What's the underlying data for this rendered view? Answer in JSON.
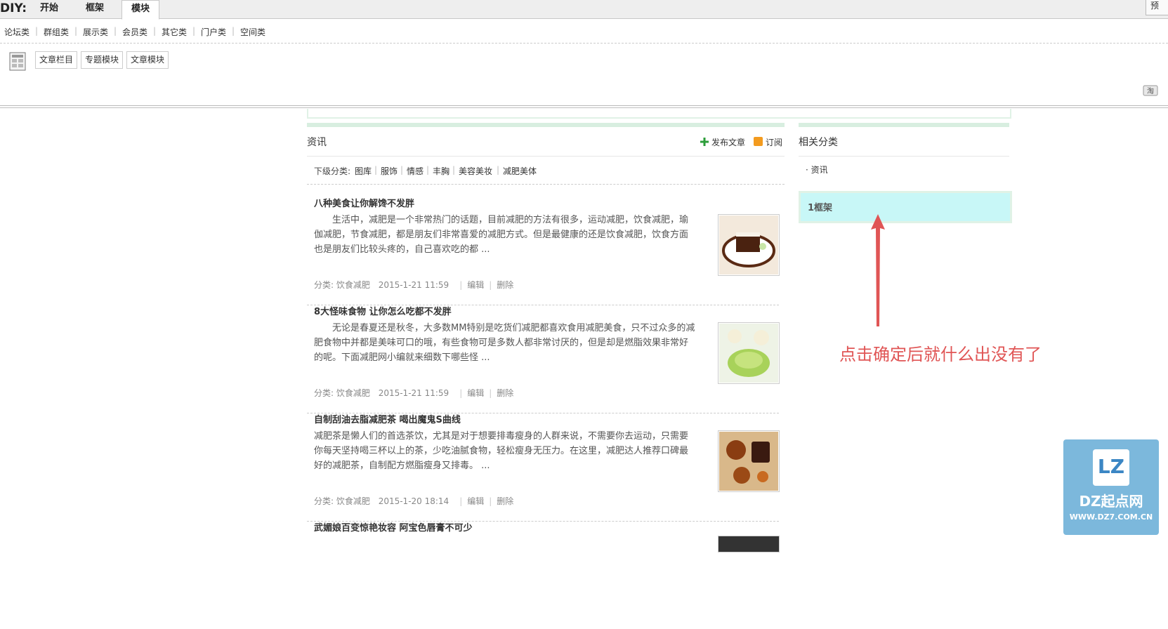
{
  "diy": {
    "label": "DIY:",
    "tabs": [
      {
        "label": "开始"
      },
      {
        "label": "框架"
      },
      {
        "label": "模块"
      }
    ],
    "right_button": "预",
    "categories": [
      "论坛类",
      "群组类",
      "展示类",
      "会员类",
      "其它类",
      "门户类",
      "空间类"
    ],
    "module_buttons": [
      "文章栏目",
      "专题模块",
      "文章模块"
    ],
    "corner_icon_text": "淘"
  },
  "main": {
    "title": "资讯",
    "publish_label": "发布文章",
    "subscribe_label": "订阅",
    "sub_label": "下级分类:",
    "sub_categories": [
      "图库",
      "服饰",
      "情感",
      "丰胸",
      "美容美妆",
      "减肥美体"
    ],
    "articles": [
      {
        "title": "八种美食让你解馋不发胖",
        "summary": "　　生活中，减肥是一个非常热门的话题，目前减肥的方法有很多，运动减肥，饮食减肥，瑜伽减肥，节食减肥，都是朋友们非常喜爱的减肥方式。但是最健康的还是饮食减肥，饮食方面也是朋友们比较头疼的，自己喜欢吃的都 ...",
        "category": "分类: 饮食减肥",
        "date": "2015-1-21 11:59",
        "edit": "编辑",
        "delete": "删除"
      },
      {
        "title": "8大怪味食物 让你怎么吃都不发胖",
        "summary": "　　无论是春夏还是秋冬，大多数MM特别是吃货们减肥都喜欢食用减肥美食，只不过众多的减肥食物中并都是美味可口的哦，有些食物可是多数人都非常讨厌的，但是却是燃脂效果非常好的呢。下面减肥网小编就来细数下哪些怪 ...",
        "category": "分类: 饮食减肥",
        "date": "2015-1-21 11:59",
        "edit": "编辑",
        "delete": "删除"
      },
      {
        "title": "自制刮油去脂减肥茶 喝出魔鬼S曲线",
        "summary": "减肥茶是懒人们的首选茶饮，尤其是对于想要排毒瘦身的人群来说，不需要你去运动，只需要你每天坚持喝三杯以上的茶，少吃油腻食物，轻松瘦身无压力。在这里，减肥达人推荐口碑最好的减肥茶，自制配方燃脂瘦身又排毒。 ...",
        "category": "分类: 饮食减肥",
        "date": "2015-1-20 18:14",
        "edit": "编辑",
        "delete": "删除"
      },
      {
        "title": "武媚娘百变惊艳妆容 阿宝色唇膏不可少",
        "summary": "",
        "category": "",
        "date": "",
        "edit": "",
        "delete": ""
      }
    ]
  },
  "side": {
    "title": "相关分类",
    "item": "资讯",
    "frame_label": "1框架"
  },
  "annotation": "点击确定后就什么出没有了",
  "logo": {
    "mark": "LZ",
    "name": "DZ起点网",
    "url": "WWW.DZ7.COM.CN"
  },
  "colors": {
    "annotation": "#e05555",
    "frame_bg": "#c8f7f7",
    "green_bar": "#d8eee0",
    "logo_bg": "#7cb8dc"
  }
}
